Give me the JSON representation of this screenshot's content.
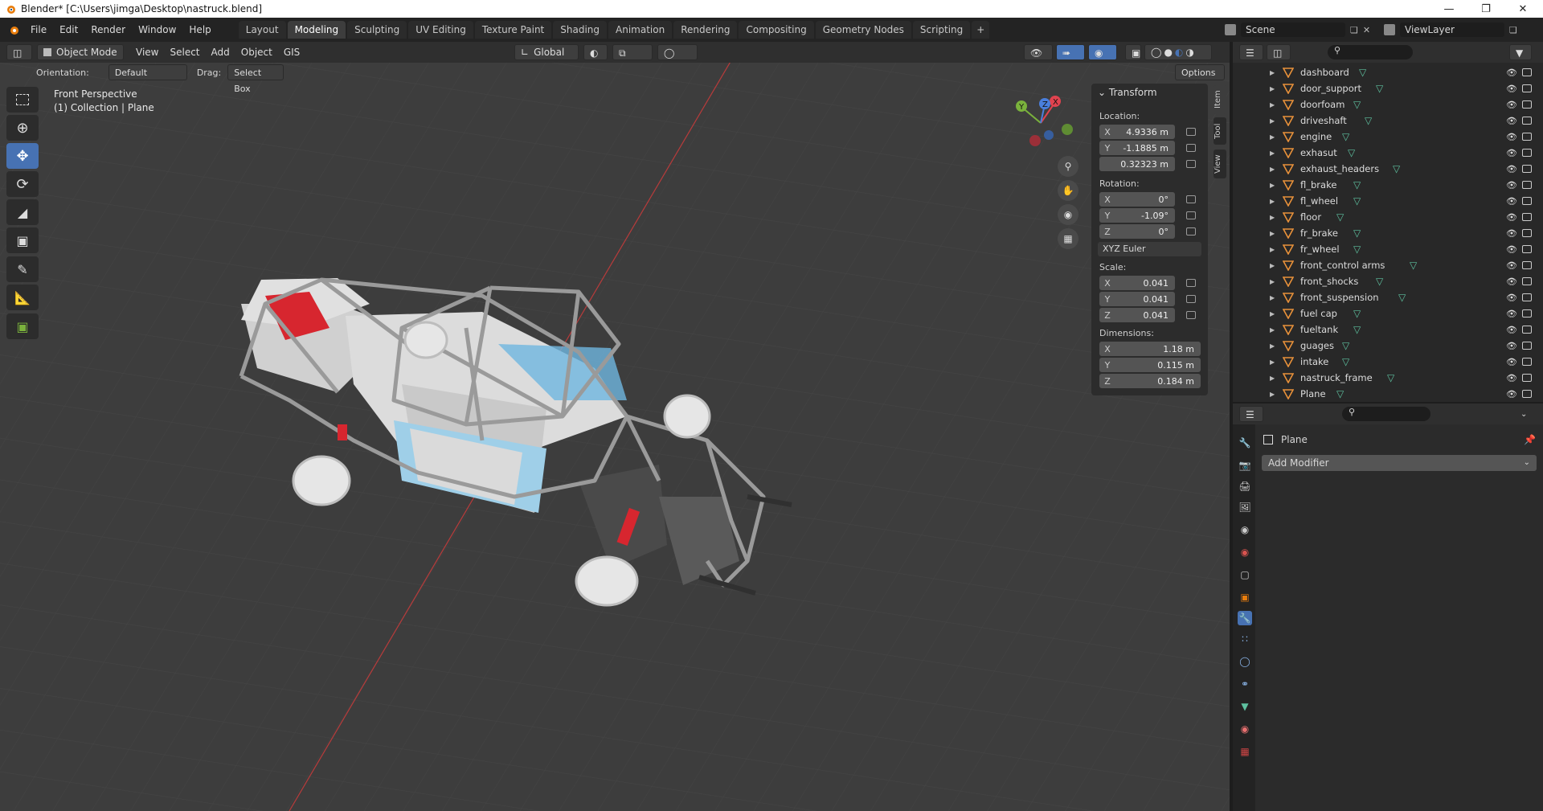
{
  "window": {
    "title": "Blender* [C:\\Users\\jimga\\Desktop\\nastruck.blend]"
  },
  "menus": [
    "File",
    "Edit",
    "Render",
    "Window",
    "Help"
  ],
  "workspaces": [
    "Layout",
    "Modeling",
    "Sculpting",
    "UV Editing",
    "Texture Paint",
    "Shading",
    "Animation",
    "Rendering",
    "Compositing",
    "Geometry Nodes",
    "Scripting"
  ],
  "active_workspace": "Modeling",
  "scene": {
    "name": "Scene",
    "view_layer": "ViewLayer"
  },
  "header": {
    "mode": "Object Mode",
    "menus": [
      "View",
      "Select",
      "Add",
      "Object",
      "GIS"
    ],
    "transform_orientation": "Global"
  },
  "tool_options": {
    "orientation_label": "Orientation:",
    "orientation_value": "Default",
    "drag_label": "Drag:",
    "drag_value": "Select Box",
    "options_label": "Options"
  },
  "viewport": {
    "view_name": "Front Perspective",
    "collection_info": "(1) Collection | Plane"
  },
  "gizmo": {
    "x": "X",
    "y": "Y",
    "z": "Z"
  },
  "n_panel": {
    "tabs": [
      "Item",
      "Tool",
      "View"
    ],
    "section": "Transform",
    "location_label": "Location:",
    "location": [
      {
        "axis": "X",
        "value": "4.9336 m"
      },
      {
        "axis": "Y",
        "value": "-1.1885 m"
      },
      {
        "axis": "",
        "value": "0.32323 m"
      }
    ],
    "rotation_label": "Rotation:",
    "rotation": [
      {
        "axis": "X",
        "value": "0°"
      },
      {
        "axis": "Y",
        "value": "-1.09°"
      },
      {
        "axis": "Z",
        "value": "0°"
      }
    ],
    "rotation_mode": "XYZ Euler",
    "scale_label": "Scale:",
    "scale": [
      {
        "axis": "X",
        "value": "0.041"
      },
      {
        "axis": "Y",
        "value": "0.041"
      },
      {
        "axis": "Z",
        "value": "0.041"
      }
    ],
    "dimensions_label": "Dimensions:",
    "dimensions": [
      {
        "axis": "X",
        "value": "1.18 m"
      },
      {
        "axis": "Y",
        "value": "0.115 m"
      },
      {
        "axis": "Z",
        "value": "0.184 m"
      }
    ]
  },
  "outliner": {
    "items": [
      "dashboard",
      "door_support",
      "doorfoam",
      "driveshaft",
      "engine",
      "exhasut",
      "exhaust_headers",
      "fl_brake",
      "fl_wheel",
      "floor",
      "fr_brake",
      "fr_wheel",
      "front_control arms",
      "front_shocks",
      "front_suspension",
      "fuel cap",
      "fueltank",
      "guages",
      "intake",
      "nastruck_frame",
      "Plane"
    ]
  },
  "properties": {
    "object_name": "Plane",
    "add_modifier_label": "Add Modifier"
  },
  "colors": {
    "accent": "#4772b3",
    "x_axis": "#e0434f",
    "y_axis": "#7ab23c",
    "z_axis": "#4a7fdc",
    "frame": "#9a9a9a",
    "body": "#d4d4d4",
    "red_panel": "#d7262f",
    "blue_panel": "#6fb6e0"
  }
}
